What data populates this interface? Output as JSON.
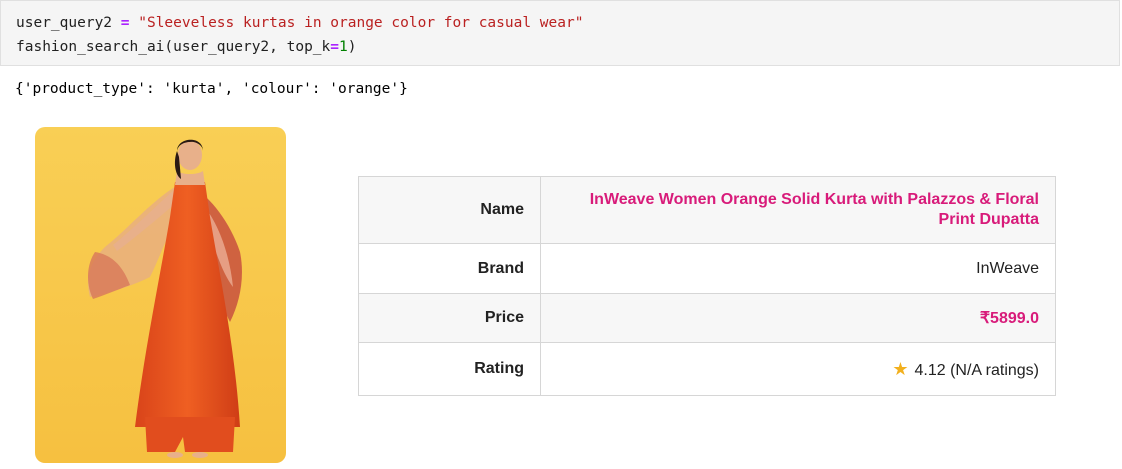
{
  "code": {
    "line1": {
      "var": "user_query2",
      "op": "=",
      "string": "\"Sleeveless kurtas in orange color for casual wear\""
    },
    "line2": {
      "func": "fashion_search_ai(user_query2, top_k",
      "op": "=",
      "num": "1",
      "close": ")"
    }
  },
  "output": {
    "text": "{'product_type': 'kurta', 'colour': 'orange'}"
  },
  "product": {
    "image_alt": "Woman in orange sleeveless kurta with floral print dupatta",
    "table": {
      "name_label": "Name",
      "name_value": "InWeave Women Orange Solid Kurta with Palazzos & Floral Print Dupatta",
      "brand_label": "Brand",
      "brand_value": "InWeave",
      "price_label": "Price",
      "price_value": "₹5899.0",
      "rating_label": "Rating",
      "rating_value": "4.12 (N/A ratings)"
    }
  },
  "colors": {
    "accent": "#d81b7a",
    "background_image": "#f8c84a",
    "kurta": "#e8541c",
    "star": "#f2b01e"
  },
  "icons": {
    "rating": "star-icon"
  }
}
